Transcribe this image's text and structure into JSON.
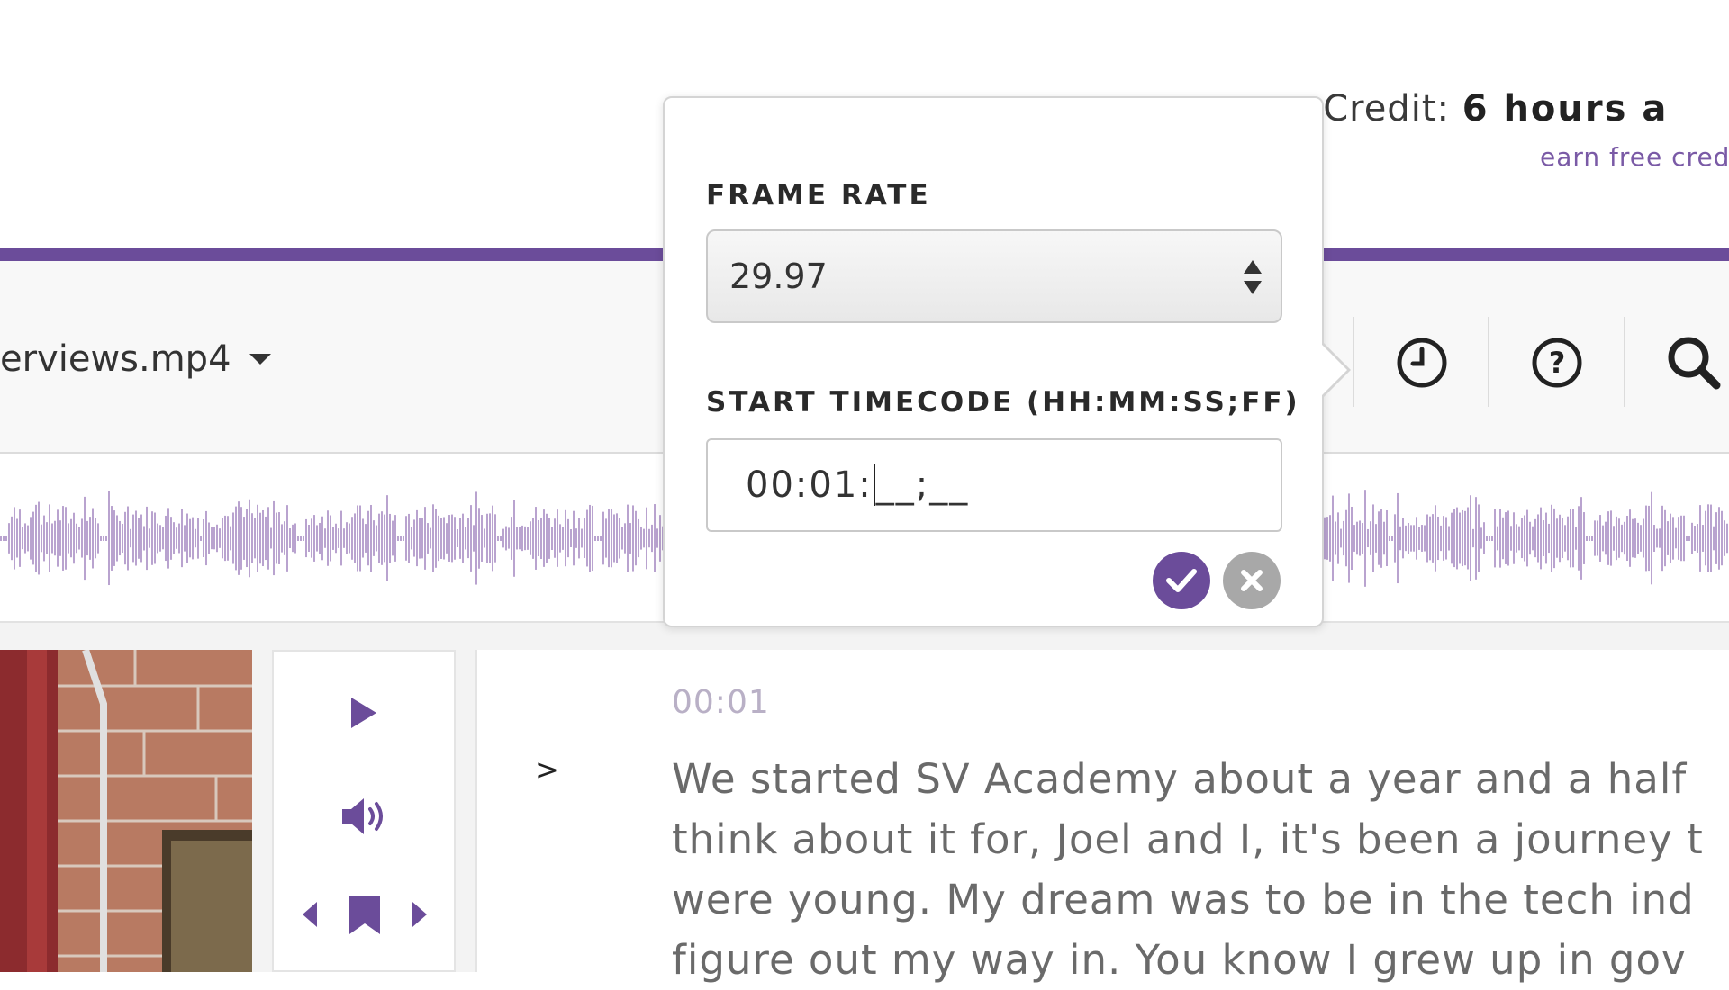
{
  "header": {
    "credit_label": "am Credit:",
    "credit_value": "6 hours a",
    "earn_link": "earn free cred"
  },
  "toolbar": {
    "file_name": "erviews.mp4",
    "icons": [
      "clock-icon",
      "help-icon",
      "search-icon"
    ]
  },
  "popover": {
    "frame_rate_label": "FRAME RATE",
    "frame_rate_value": "29.97",
    "start_timecode_label": "START TIMECODE (HH:MM:SS;FF)",
    "timecode_typed": "00:01:",
    "timecode_remaining": "__;__",
    "confirm_icon": "checkmark-icon",
    "cancel_icon": "close-icon"
  },
  "player_controls": {
    "icons": [
      "play-icon",
      "volume-icon",
      "prev-icon",
      "bookmark-icon",
      "next-icon"
    ]
  },
  "transcript": {
    "expand_symbol": ">",
    "timestamp": "00:01",
    "lines": [
      "We started SV Academy about a year and a half",
      "think about it for, Joel and I, it's been a journey t",
      "were young. My dream was to be in the tech ind",
      "figure out my way in. You know I grew up in gov"
    ]
  },
  "colors": {
    "accent": "#6b4c9a",
    "waveform": "#b9a3cf",
    "link": "#7a5aa6"
  }
}
